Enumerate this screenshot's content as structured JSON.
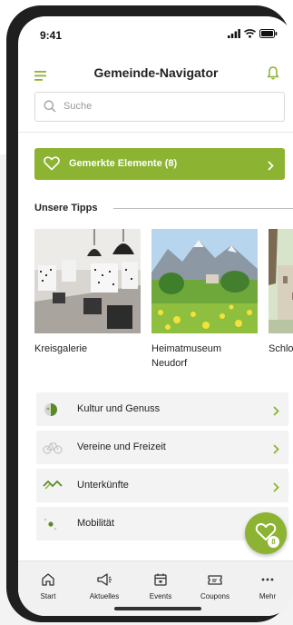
{
  "status_bar": {
    "time": "9:41"
  },
  "header": {
    "title": "Gemeinde-Navigator"
  },
  "search": {
    "placeholder": "Suche"
  },
  "favorites_button": {
    "label": "Gemerkte Elemente (8)"
  },
  "tips": {
    "title": "Unsere Tipps",
    "cards": [
      {
        "title": "Kreisgalerie"
      },
      {
        "title": "Heimatmuseum Neudorf"
      },
      {
        "title": "Schloss"
      }
    ]
  },
  "categories": [
    {
      "label": "Kultur und Genuss",
      "icon": "culture-icon"
    },
    {
      "label": "Vereine und Freizeit",
      "icon": "bicycle-icon"
    },
    {
      "label": "Unterkünfte",
      "icon": "roof-icon"
    },
    {
      "label": "Mobilität",
      "icon": "mobility-icon"
    }
  ],
  "fab": {
    "badge": "8",
    "icon": "heart-plus-icon"
  },
  "tabbar": [
    {
      "label": "Start",
      "icon": "home-icon"
    },
    {
      "label": "Aktuelles",
      "icon": "megaphone-icon"
    },
    {
      "label": "Events",
      "icon": "calendar-icon"
    },
    {
      "label": "Coupons",
      "icon": "ticket-icon"
    },
    {
      "label": "Mehr",
      "icon": "more-icon"
    }
  ],
  "colors": {
    "accent": "#8cb332",
    "list_bg": "#f3f3f3",
    "tabbar_bg": "#f1f1f1"
  }
}
